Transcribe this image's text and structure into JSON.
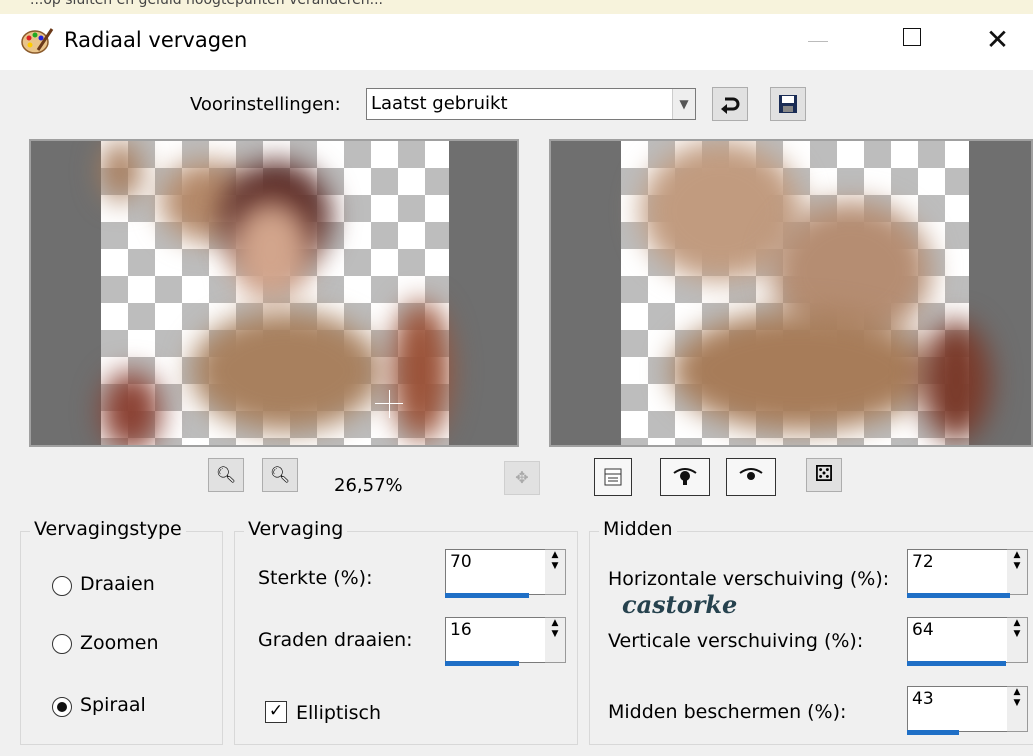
{
  "top_strip_text": "...op sluiten en geluid hoogtepunten veranderen...",
  "window": {
    "title": "Radiaal vervagen",
    "close_glyph": "✕"
  },
  "presets": {
    "label": "Voorinstellingen:",
    "value": "Laatst gebruikt"
  },
  "toolbar": {
    "reset_icon": "reset-arrow-icon",
    "save_icon": "floppy-save-icon",
    "zoom_out_glyph": "🔍︎",
    "zoom_in_glyph": "🔍︎",
    "zoom_level": "26,57%",
    "move_glyph": "✥",
    "dice_glyph": "⚄"
  },
  "blur_type": {
    "title": "Vervagingstype",
    "options": [
      {
        "label": "Draaien",
        "selected": false
      },
      {
        "label": "Zoomen",
        "selected": false
      },
      {
        "label": "Spiraal",
        "selected": true
      }
    ]
  },
  "blur": {
    "title": "Vervaging",
    "strength": {
      "label": "Sterkte (%):",
      "value": "70",
      "fill": 0.7
    },
    "rotate": {
      "label": "Graden draaien:",
      "value": "16",
      "fill": 0.63
    },
    "elliptic": {
      "label": "Elliptisch",
      "checked": true,
      "check_glyph": "✓"
    }
  },
  "center": {
    "title": "Midden",
    "horizontal": {
      "label": "Horizontale verschuiving (%):",
      "value": "72",
      "fill": 0.86
    },
    "vertical": {
      "label": "Verticale verschuiving (%):",
      "value": "64",
      "fill": 0.82
    },
    "protect": {
      "label": "Midden beschermen (%):",
      "value": "43",
      "fill": 0.43
    }
  },
  "watermark": "castorke",
  "colors": {
    "accent": "#1f6fc6",
    "preview_bg": "#6f6f6f"
  }
}
